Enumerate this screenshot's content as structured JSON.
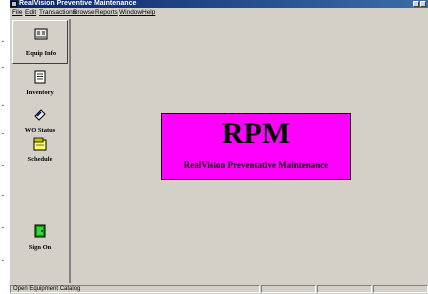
{
  "window": {
    "title": "RealVision Preventive Maintenance"
  },
  "menu": [
    {
      "label": "File"
    },
    {
      "label": "Edit"
    },
    {
      "label": "Transactions"
    },
    {
      "label": "Browse"
    },
    {
      "label": "Reports"
    },
    {
      "label": "Window"
    },
    {
      "label": "Help"
    }
  ],
  "nav": {
    "items": [
      {
        "label": "Equip Info",
        "icon": "equipment-icon",
        "selected": true
      },
      {
        "label": "Inventory",
        "icon": "inventory-list-icon",
        "selected": false
      },
      {
        "label": "WO Status",
        "icon": "wrench-icon",
        "selected": false
      },
      {
        "label": "Schedule",
        "icon": "calendar-icon",
        "selected": false
      },
      {
        "label": "Sign On",
        "icon": "door-icon",
        "selected": false
      }
    ]
  },
  "splash": {
    "title": "RPM",
    "subtitle": "RealVision Preventative Maintenance",
    "background": "#ff00ff"
  },
  "status": {
    "text": "Open Equipment Catalog"
  },
  "colors": {
    "title_bar": "#0a246a",
    "face": "#d4d0c8"
  }
}
